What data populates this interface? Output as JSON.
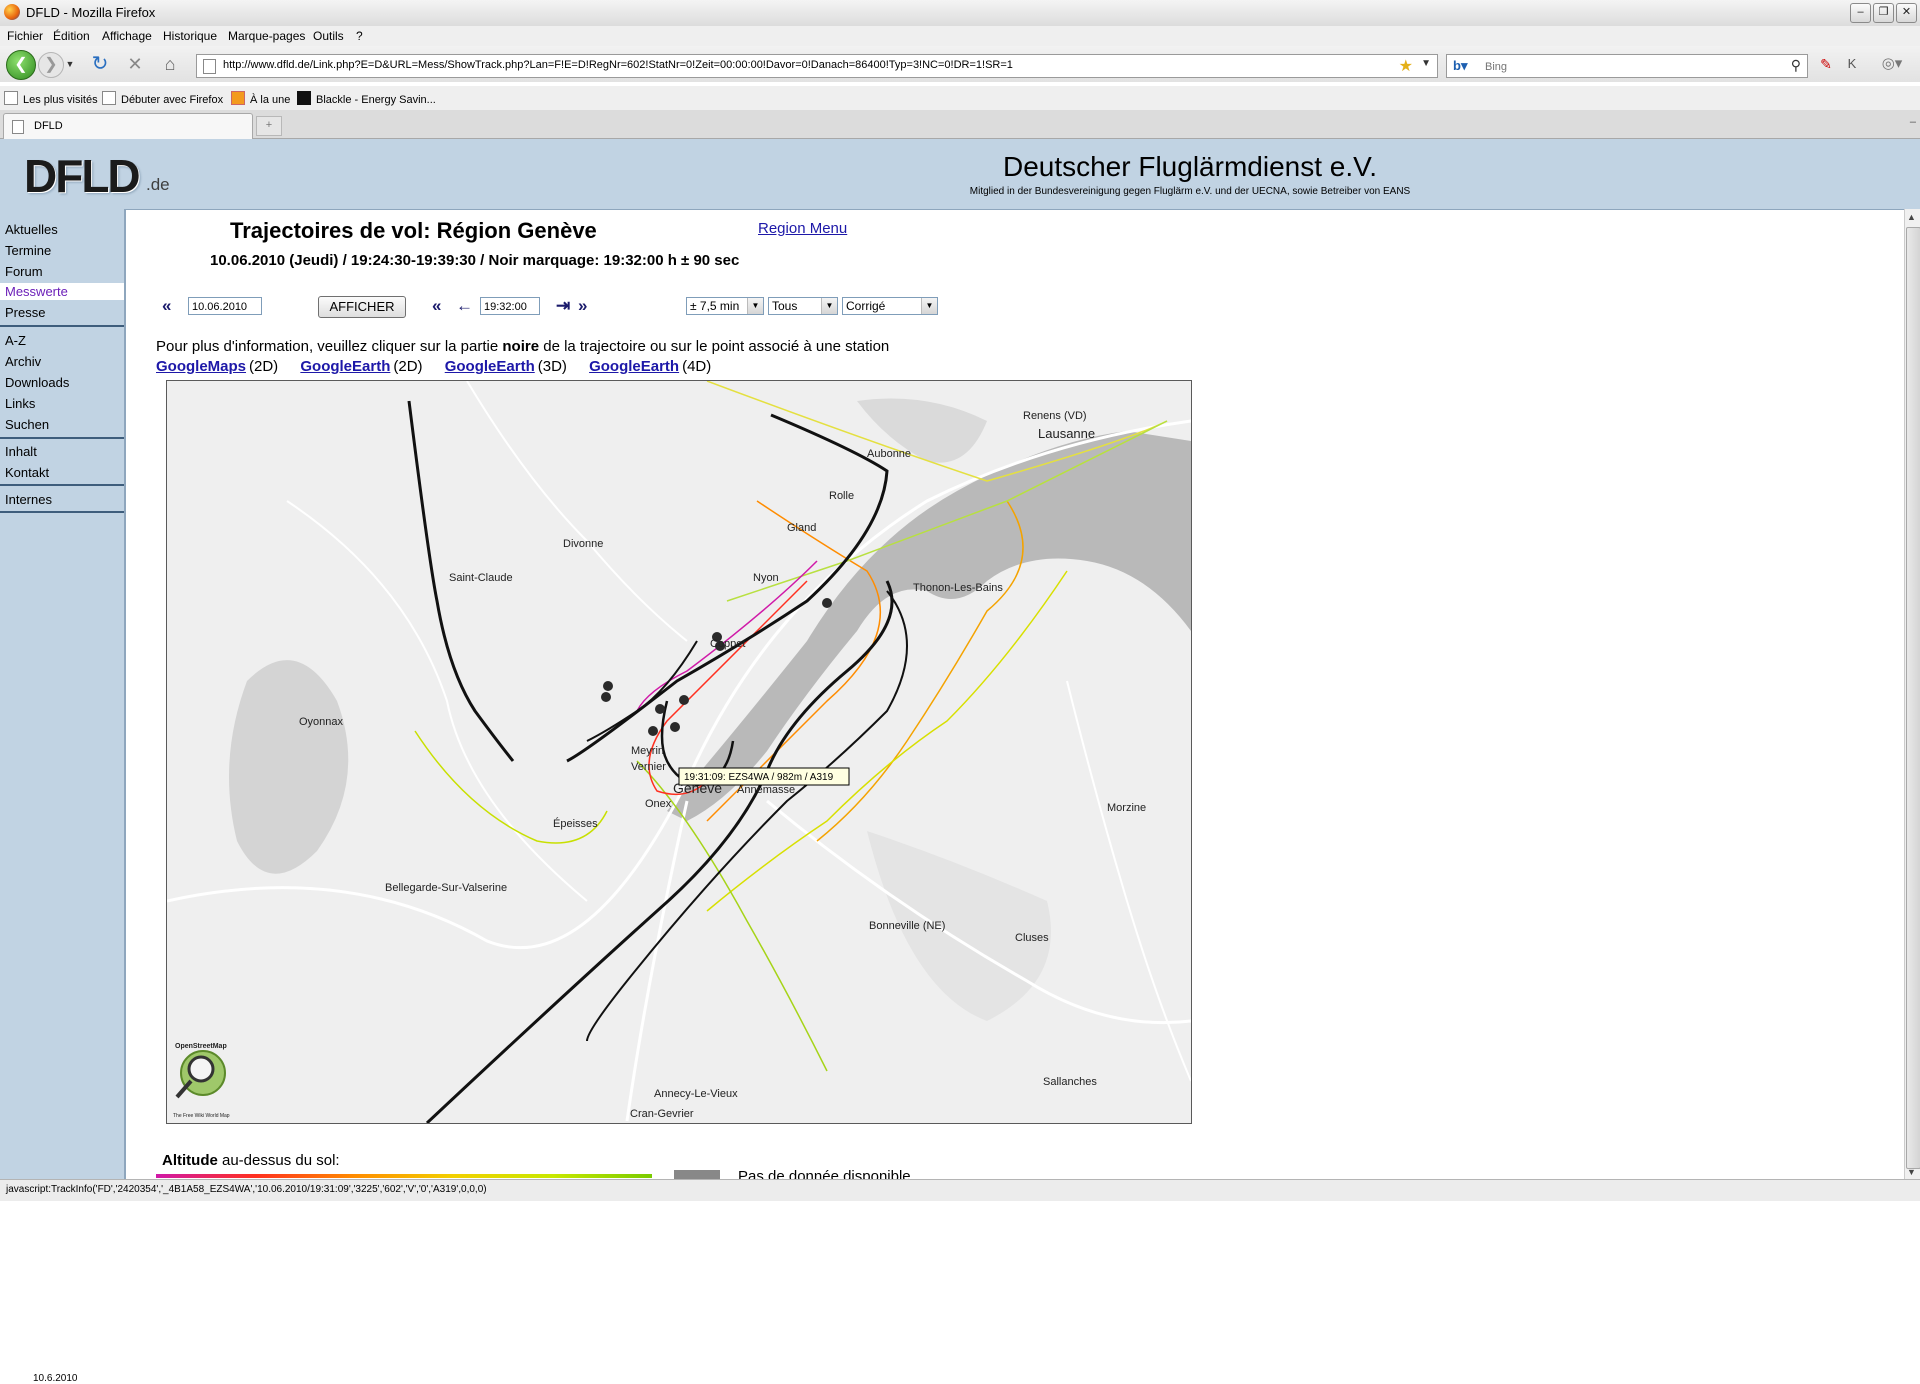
{
  "window": {
    "title": "DFLD - Mozilla Firefox"
  },
  "menu": [
    "Fichier",
    "Édition",
    "Affichage",
    "Historique",
    "Marque-pages",
    "Outils",
    "?"
  ],
  "nav": {
    "url": "http://www.dfld.de/Link.php?E=D&URL=Mess/ShowTrack.php?Lan=F!E=D!RegNr=602!StatNr=0!Zeit=00:00:00!Davor=0!Danach=86400!Typ=3!NC=0!DR=1!SR=1",
    "search_placeholder": "Bing"
  },
  "bookmarks": [
    "Les plus visités",
    "Débuter avec Firefox",
    "À la une",
    "Blackle - Energy Savin..."
  ],
  "tab": {
    "label": "DFLD"
  },
  "site": {
    "logo": "DFLD",
    "logo_suffix": ".de",
    "title": "Deutscher Fluglärmdienst e.V.",
    "subtitle": "Mitglied in der Bundesvereinigung gegen Fluglärm e.V. und der UECNA, sowie Betreiber von EANS"
  },
  "sidebar": {
    "group1": [
      "Aktuelles",
      "Termine",
      "Forum",
      "Messwerte",
      "Presse"
    ],
    "group2": [
      "A-Z",
      "Archiv",
      "Downloads",
      "Links",
      "Suchen"
    ],
    "group3": [
      "Inhalt",
      "Kontakt"
    ],
    "group4": [
      "Internes"
    ],
    "active_color": "#6b1fb8"
  },
  "page": {
    "heading": "Trajectoires de vol: Région Genève",
    "subheading": "10.06.2010 (Jeudi) / 19:24:30-19:39:30 / Noir marquage: 19:32:00 h ± 90 sec",
    "region_menu": "Region Menu",
    "date_value": "10.06.2010",
    "afficher": "AFFICHER",
    "time_value": "19:32:00",
    "range_select": "± 7,5 min",
    "tous_select": "Tous",
    "corrige_select": "Corrigé",
    "info_pre": "Pour plus d'information, veuillez cliquer sur la partie ",
    "info_bold": "noire",
    "info_post": " de la trajectoire ou sur le point associé à une station",
    "links": [
      {
        "label": "GoogleMaps",
        "suffix": "(2D)"
      },
      {
        "label": "GoogleEarth",
        "suffix": "(2D)"
      },
      {
        "label": "GoogleEarth",
        "suffix": "(3D)"
      },
      {
        "label": "GoogleEarth",
        "suffix": "(4D)"
      }
    ],
    "legend_label_bold": "Altitude",
    "legend_label_rest": " au-dessus du sol:",
    "legend_pdd": "Pas de donnée disponible",
    "date_footer": "10.6.2010"
  },
  "map": {
    "places": [
      "Lausanne",
      "Renens (VD)",
      "Aubonne",
      "Rolle",
      "Gland",
      "Nyon",
      "Saint-Claude",
      "Thonon-Les-Bains",
      "Divonne",
      "Coppet",
      "Oyonnax",
      "Meyrin",
      "Vernier",
      "Onex",
      "Genève",
      "Annemasse",
      "Épeisses",
      "Bellegarde-Sur-Valserine",
      "Bonneville (NE)",
      "Cluses",
      "Morzine",
      "Sallanches",
      "Annecy-Le-Vieux",
      "Cran-Gevrier"
    ],
    "tooltip": "19:31:09: EZS4WA / 982m / A319",
    "osm_label": "OpenStreetMap",
    "osm_tag": "The Free Wiki World Map"
  },
  "status": "javascript:TrackInfo('FD','2420354','_4B1A58_EZS4WA','10.06.2010/19:31:09','3225','602','V','0','A319',0,0,0)"
}
